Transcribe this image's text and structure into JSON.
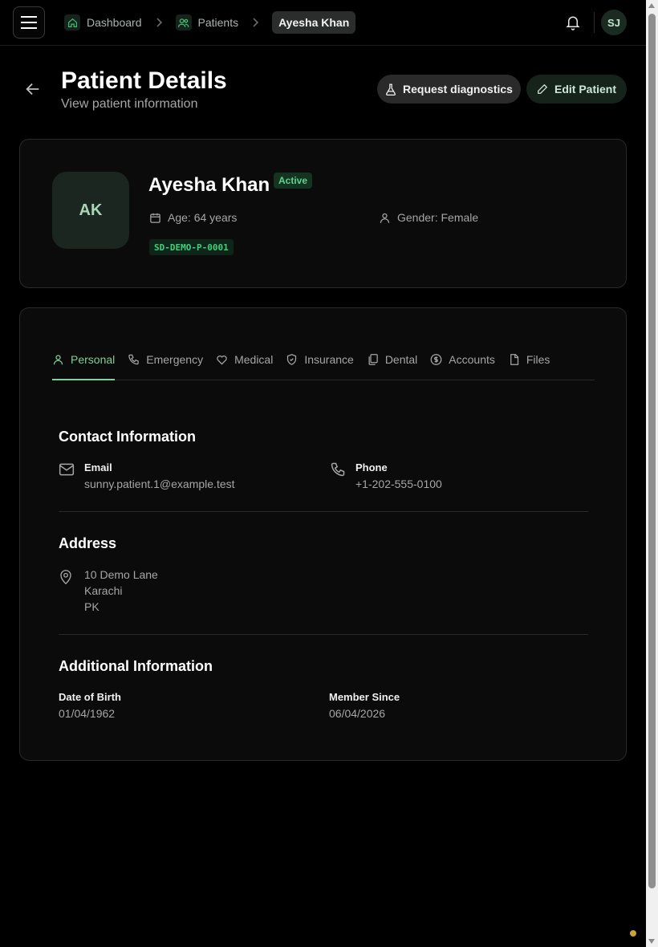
{
  "breadcrumb": {
    "items": [
      {
        "label": "Dashboard",
        "icon": "home-icon"
      },
      {
        "label": "Patients",
        "icon": "users-icon"
      }
    ],
    "current": "Ayesha Khan"
  },
  "user": {
    "initials": "SJ"
  },
  "header": {
    "title": "Patient Details",
    "subtitle": "View patient information",
    "request_diagnostics_label": "Request diagnostics",
    "edit_patient_label": "Edit Patient"
  },
  "patient": {
    "initials": "AK",
    "name": "Ayesha Khan",
    "status": "Active",
    "age": "Age: 64 years",
    "gender": "Gender: Female",
    "id": "SD-DEMO-P-0001"
  },
  "tabs": [
    {
      "label": "Personal",
      "icon": "user-icon",
      "active": true
    },
    {
      "label": "Emergency",
      "icon": "phone-icon",
      "active": false
    },
    {
      "label": "Medical",
      "icon": "heart-icon",
      "active": false
    },
    {
      "label": "Insurance",
      "icon": "shield-icon",
      "active": false
    },
    {
      "label": "Dental",
      "icon": "copy-icon",
      "active": false
    },
    {
      "label": "Accounts",
      "icon": "dollar-icon",
      "active": false
    },
    {
      "label": "Files",
      "icon": "file-icon",
      "active": false
    }
  ],
  "contact": {
    "title": "Contact Information",
    "email_label": "Email",
    "email_value": "sunny.patient.1@example.test",
    "phone_label": "Phone",
    "phone_value": "+1-202-555-0100"
  },
  "address": {
    "title": "Address",
    "line1": "10 Demo Lane",
    "line2": "Karachi",
    "line3": "PK"
  },
  "additional": {
    "title": "Additional Information",
    "dob_label": "Date of Birth",
    "dob_value": "01/04/1962",
    "member_label": "Member Since",
    "member_value": "06/04/2026"
  },
  "colors": {
    "accent": "#7fd19a",
    "status_green": "#5fd38b",
    "background": "#000000",
    "card": "#0b0b0b"
  }
}
